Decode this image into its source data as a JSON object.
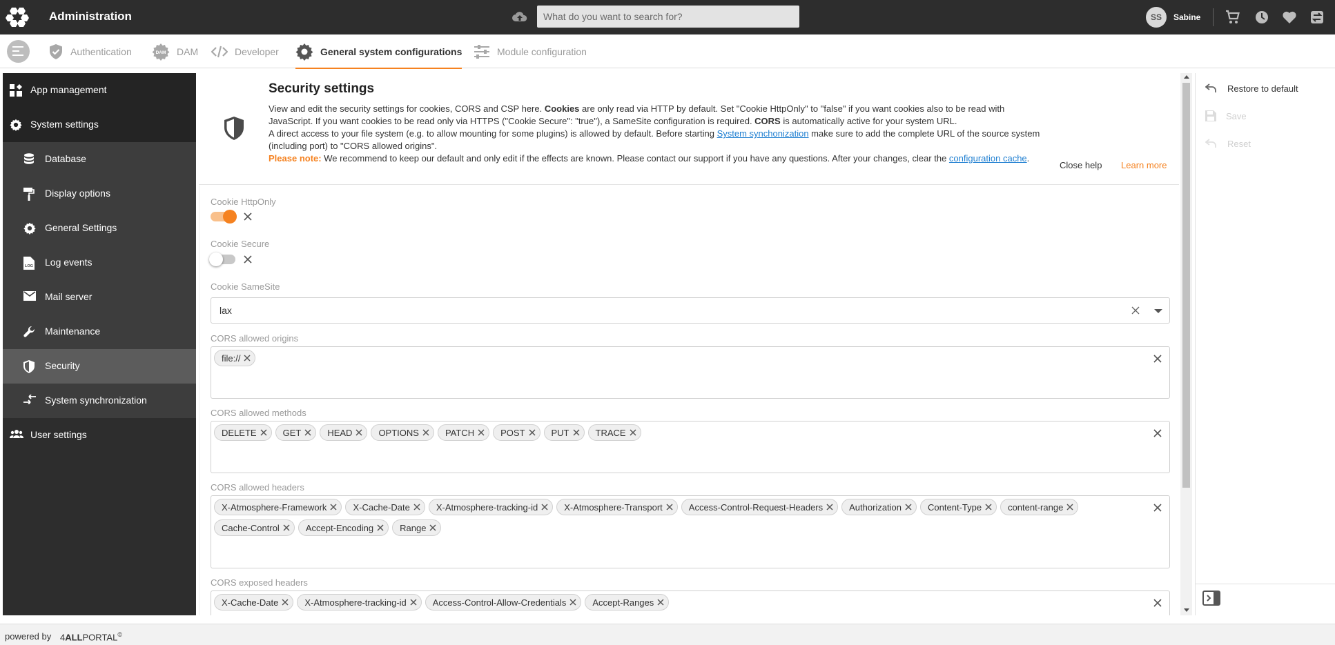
{
  "app": {
    "title": "Administration"
  },
  "search": {
    "placeholder": "What do you want to search for?",
    "value": ""
  },
  "user": {
    "initials": "SS",
    "name": "Sabine"
  },
  "tabs": [
    {
      "label": "Authentication",
      "icon": "shield-check-icon"
    },
    {
      "label": "DAM",
      "icon": "dam-gear-icon"
    },
    {
      "label": "Developer",
      "icon": "code-icon"
    },
    {
      "label": "General system configurations",
      "icon": "gear-icon",
      "active": true
    },
    {
      "label": "Module configuration",
      "icon": "sliders-icon"
    }
  ],
  "sidebar": {
    "items": [
      {
        "label": "App management",
        "icon": "app-grid-icon"
      },
      {
        "label": "System settings",
        "icon": "gear-icon"
      },
      {
        "label": "Database",
        "icon": "database-icon"
      },
      {
        "label": "Display options",
        "icon": "paint-roller-icon"
      },
      {
        "label": "General Settings",
        "icon": "gear-icon"
      },
      {
        "label": "Log events",
        "icon": "log-file-icon"
      },
      {
        "label": "Mail server",
        "icon": "mail-icon"
      },
      {
        "label": "Maintenance",
        "icon": "wrench-icon"
      },
      {
        "label": "Security",
        "icon": "shield-icon",
        "active": true
      },
      {
        "label": "System synchronization",
        "icon": "sync-arrows-icon"
      },
      {
        "label": "User settings",
        "icon": "users-icon"
      }
    ]
  },
  "help": {
    "title": "Security settings",
    "p1_a": "View and edit the security settings for cookies, CORS and CSP here. ",
    "p1_b": "Cookies",
    "p1_c": " are only read via HTTP by default. Set \"Cookie HttpOnly\" to \"false\" if you want cookies also to be read with JavaScript. If you want cookies to be read only via HTTPS (\"Cookie Secure\": \"true\"), a SameSite configuration is required. ",
    "p1_d": "CORS",
    "p1_e": " is automatically active for your system URL.",
    "p2_a": "A direct access to your file system (e.g. to allow mounting for some plugins) is allowed by default. Before starting ",
    "p2_link": "System synchonization",
    "p2_b": " make sure to add the complete URL of the source system (including port) to \"CORS allowed origins\".",
    "note_label": "Please note:",
    "p3_a": " We recommend to keep our default and only edit if the effects are known. Please contact our support if you have any questions. After your changes, clear the ",
    "p3_link": "configuration cache",
    "p3_b": ".",
    "close_label": "Close help",
    "learn_label": "Learn more"
  },
  "form": {
    "httponly": {
      "label": "Cookie HttpOnly",
      "value": true
    },
    "secure": {
      "label": "Cookie Secure",
      "value": false
    },
    "samesite": {
      "label": "Cookie SameSite",
      "value": "lax"
    },
    "origins": {
      "label": "CORS allowed origins",
      "chips": [
        "file://"
      ]
    },
    "methods": {
      "label": "CORS allowed methods",
      "chips": [
        "DELETE",
        "GET",
        "HEAD",
        "OPTIONS",
        "PATCH",
        "POST",
        "PUT",
        "TRACE"
      ]
    },
    "headers": {
      "label": "CORS allowed headers",
      "chips": [
        "X-Atmosphere-Framework",
        "X-Cache-Date",
        "X-Atmosphere-tracking-id",
        "X-Atmosphere-Transport",
        "Access-Control-Request-Headers",
        "Authorization",
        "Content-Type",
        "content-range",
        "Cache-Control",
        "Accept-Encoding",
        "Range"
      ]
    },
    "exposed": {
      "label": "CORS exposed headers",
      "chips": [
        "X-Cache-Date",
        "X-Atmosphere-tracking-id",
        "Access-Control-Allow-Credentials",
        "Accept-Ranges"
      ]
    }
  },
  "actions": {
    "restore": "Restore to default",
    "save": "Save",
    "reset": "Reset"
  },
  "footer": {
    "powered": "powered by",
    "brand_num": "4",
    "brand_bold": "ALL",
    "brand_rest": "PORTAL",
    "brand_mark": "©"
  },
  "colors": {
    "accent": "#f58220",
    "topbar": "#2d2d2d",
    "sidebar": "#2d2d2d",
    "link": "#1f7fd1"
  }
}
